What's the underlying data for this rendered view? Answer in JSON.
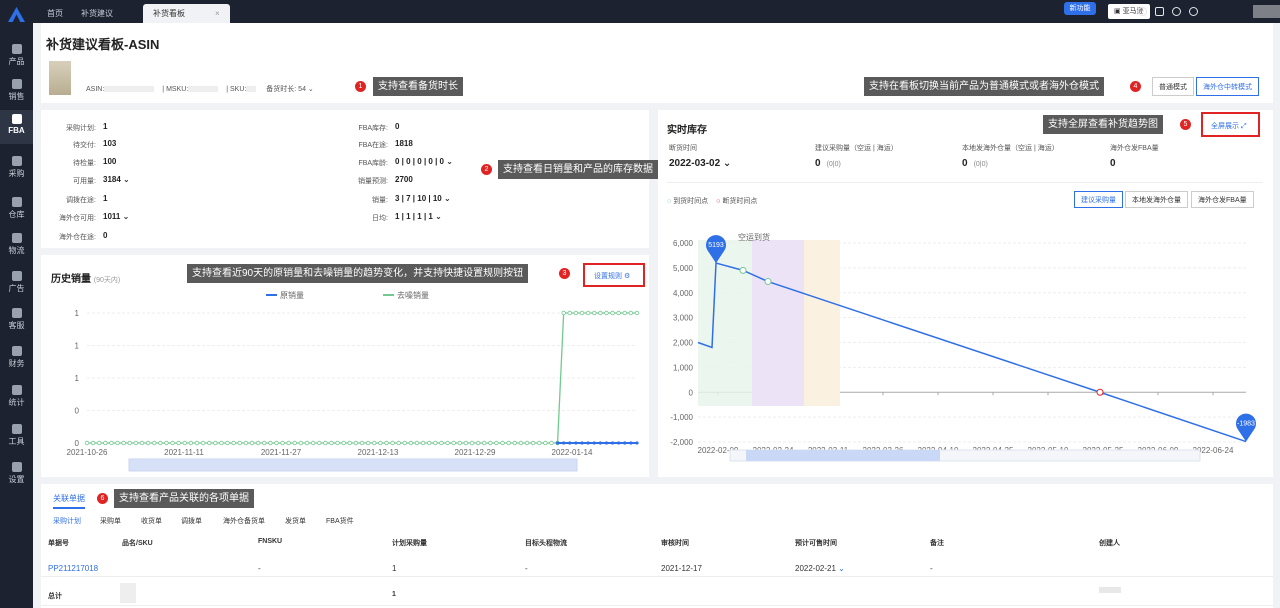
{
  "topbar": {
    "tabs": [
      "首页",
      "补货建议",
      "补货看板"
    ],
    "new_feature": "新功能",
    "amazon": "亚马逊"
  },
  "sidebar": {
    "items": [
      "产品",
      "销售",
      "FBA",
      "采购",
      "仓库",
      "物流",
      "广告",
      "客服",
      "财务",
      "统计",
      "工具",
      "设置"
    ]
  },
  "header": {
    "title": "补货建议看板-ASIN",
    "asin_label": "ASIN:",
    "msku_label": "MSKU:",
    "sku_label": "SKU:",
    "stock_duration": "备货时长: 54",
    "mode_normal": "普通模式",
    "mode_overseas": "海外仓中转模式"
  },
  "callouts": {
    "c1": "支持查看备货时长",
    "c2": "支持查看日销量和产品的库存数据",
    "c3": "支持查看近90天的原销量和去噪销量的趋势变化，并支持快捷设置规则按钮",
    "c4": "支持在看板切换当前产品为普通模式或者海外仓模式",
    "c5": "支持全屏查看补货趋势图",
    "c6": "支持查看产品关联的各项单据"
  },
  "nums": [
    "1",
    "2",
    "3",
    "4",
    "5",
    "6"
  ],
  "stats": {
    "left": [
      {
        "label": "采购计划:",
        "value": "1"
      },
      {
        "label": "待交付:",
        "value": "103"
      },
      {
        "label": "待检量:",
        "value": "100"
      },
      {
        "label": "可用量:",
        "value": "3184"
      },
      {
        "label": "调拨在途:",
        "value": "1"
      },
      {
        "label": "海外仓可用:",
        "value": "1011"
      },
      {
        "label": "海外仓在途:",
        "value": "0"
      }
    ],
    "right": [
      {
        "label": "FBA库存:",
        "value": "0"
      },
      {
        "label": "FBA在途:",
        "value": "1818"
      },
      {
        "label": "FBA库龄:",
        "value": "0 | 0 | 0 | 0 | 0"
      },
      {
        "label": "销量预测:",
        "value": "2700"
      },
      {
        "label": "销量:",
        "value": "3 | 7 | 10 | 10"
      },
      {
        "label": "日均:",
        "value": "1 | 1 | 1 | 1"
      }
    ]
  },
  "history": {
    "title": "历史销量",
    "subtitle": "(90天内)",
    "settings": "设置规则 ⚙",
    "legend_raw": "原销量",
    "legend_denoise": "去噪销量",
    "xticks": [
      "2021-10-26",
      "2021-11-11",
      "2021-11-27",
      "2021-12-13",
      "2021-12-29",
      "2022-01-14"
    ],
    "yticks": [
      "0",
      "0",
      "1",
      "1",
      "1"
    ]
  },
  "inventory": {
    "title": "实时库存",
    "fullscreen": "全屏展示 ⤢",
    "cols": [
      {
        "label": "断货时间",
        "value": "2022-03-02"
      },
      {
        "label": "建议采购量（空运 | 海运）",
        "value": "0",
        "sub": "(0|0)"
      },
      {
        "label": "本地发海外仓量（空运 | 海运）",
        "value": "0",
        "sub": "(0|0)"
      },
      {
        "label": "海外仓发FBA量",
        "value": "0",
        "sub": ""
      }
    ],
    "legend_arrive": "到货时间点",
    "legend_out": "断货时间点",
    "seg": [
      "建议采购量",
      "本地发海外仓量",
      "海外仓发FBA量"
    ],
    "air": "空运到货",
    "peak_label": "5193",
    "end_label": "-1983",
    "yticks": [
      "6,000",
      "5,000",
      "4,000",
      "3,000",
      "2,000",
      "1,000",
      "0",
      "-1,000",
      "-2,000"
    ],
    "xticks": [
      "2022-02-09",
      "2022-02-24",
      "2022-03-11",
      "2022-03-26",
      "2022-04-10",
      "2022-04-25",
      "2022-05-10",
      "2022-05-25",
      "2022-06-09",
      "2022-06-24"
    ]
  },
  "orders": {
    "tab": "关联单据",
    "subtabs": [
      "采购计划",
      "采购单",
      "收货单",
      "调拨单",
      "海外仓备货单",
      "发货单",
      "FBA货件"
    ],
    "headers": [
      "单据号",
      "品名/SKU",
      "FNSKU",
      "计划采购量",
      "目标头程物流",
      "审核时间",
      "预计可售时间",
      "备注",
      "创建人"
    ],
    "row": [
      "PP211217018",
      "-",
      "1",
      "-",
      "2021-12-17",
      "2022-02-21",
      "-"
    ],
    "total_label": "总计",
    "total_value": "1"
  },
  "chart_data": [
    {
      "type": "line",
      "title": "历史销量",
      "x": [
        "2021-10-26",
        "2021-11-11",
        "2021-11-27",
        "2021-12-13",
        "2021-12-29",
        "2022-01-14",
        "2022-01-24"
      ],
      "series": [
        {
          "name": "原销量",
          "values": [
            0,
            0,
            0,
            0,
            0,
            0,
            0
          ]
        },
        {
          "name": "去噪销量",
          "values": [
            0,
            0,
            0,
            0,
            0,
            0,
            1
          ]
        }
      ],
      "ylim": [
        0,
        1
      ]
    },
    {
      "type": "line",
      "title": "实时库存",
      "x": [
        "2022-02-09",
        "2022-02-12",
        "2022-02-24",
        "2022-02-28",
        "2022-05-25",
        "2022-07-04"
      ],
      "series": [
        {
          "name": "库存",
          "values": [
            2000,
            5193,
            4900,
            4450,
            0,
            -1983
          ]
        }
      ],
      "ylim": [
        -2000,
        6000
      ]
    }
  ],
  "colors": {
    "primary": "#2f6fe8",
    "green": "#73c991",
    "red": "#e02424"
  }
}
